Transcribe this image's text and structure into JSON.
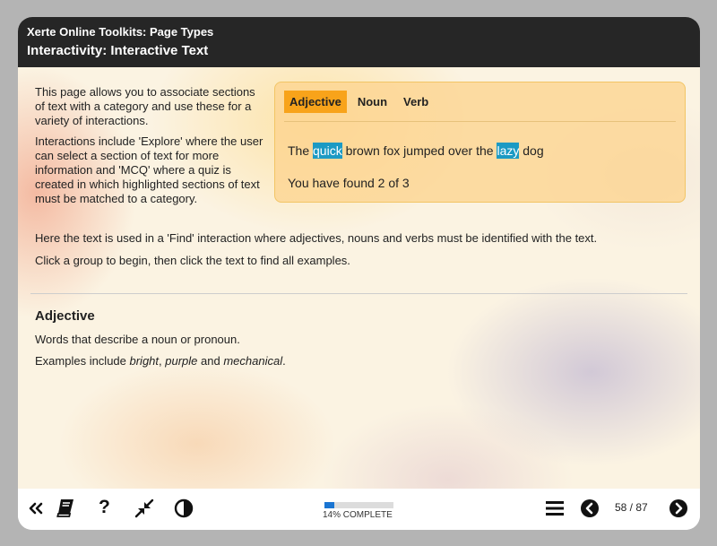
{
  "header": {
    "app_title": "Xerte Online Toolkits: Page Types",
    "page_title": "Interactivity: Interactive Text"
  },
  "intro": {
    "p1": "This page allows you to associate sections of text with a category and use these for a variety of interactions.",
    "p2": "Interactions include 'Explore' where the user can select a section of text for more information and 'MCQ' where a quiz is created in which highlighted sections of text must be matched to a category."
  },
  "panel": {
    "tabs": [
      {
        "label": "Adjective",
        "active": true
      },
      {
        "label": "Noun",
        "active": false
      },
      {
        "label": "Verb",
        "active": false
      }
    ],
    "sentence": {
      "w1": "The",
      "w2": "quick",
      "w3": "brown fox jumped over the",
      "w4": "lazy",
      "w5": "dog"
    },
    "found_text": "You have found 2 of 3"
  },
  "body": {
    "find_text": "Here the text is used in a 'Find' interaction where adjectives, nouns and verbs must be identified with the text.",
    "instruction": "Click a group to begin, then click the text to find all examples."
  },
  "category": {
    "heading": "Adjective",
    "description": "Words that describe a noun or pronoun.",
    "examples_prefix": "Examples include ",
    "ex1": "bright",
    "sep1": ", ",
    "ex2": "purple",
    "sep2": " and ",
    "ex3": "mechanical",
    "end": "."
  },
  "footer": {
    "icons": [
      "collapse-icon",
      "glossary-icon",
      "help-icon",
      "minimise-icon",
      "contrast-icon",
      "menu-icon",
      "previous-icon",
      "next-icon"
    ],
    "progress_percent": 14,
    "progress_label": "14% COMPLETE",
    "page_counter": "58 / 87"
  },
  "colors": {
    "header_bg": "#262626",
    "active_tab": "#f8a31a",
    "highlight": "#1c9ac4",
    "progress_fill": "#1a75d2"
  }
}
